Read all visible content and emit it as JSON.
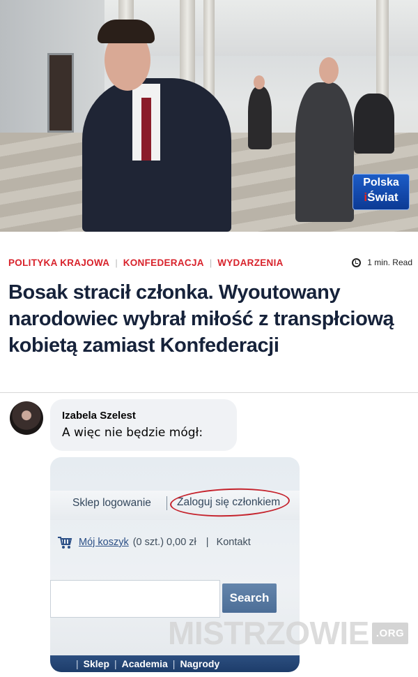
{
  "article": {
    "tv_logo": {
      "line1": "Polska",
      "dot_letter": "i",
      "line2": "Świat"
    },
    "categories": [
      "POLITYKA KRAJOWA",
      "KONFEDERACJA",
      "WYDARZENIA"
    ],
    "read_time": "1 min. Read",
    "title": "Bosak stracił członka. Wyoutowany narodowiec wybrał miłość z transpłciową kobietą zamiast Konfederacji",
    "accent_color": "#d8222b",
    "title_color": "#16223a"
  },
  "comment": {
    "author": "Izabela Szelest",
    "text": "A więc nie będzie mógł:"
  },
  "attached_image": {
    "nav": {
      "shop_login": "Sklep logowanie",
      "member_login": "Zaloguj się członkiem"
    },
    "cart": {
      "icon": "cart-icon",
      "link": "Mój koszyk",
      "summary": "(0 szt.) 0,00 zł",
      "separator": "|",
      "contact": "Kontakt"
    },
    "search_button": "Search",
    "bottom_nav": [
      "Sklep",
      "Academia",
      "Nagrody"
    ],
    "highlight_color": "#c5222c"
  },
  "watermark": {
    "text": "MISTRZOWIE",
    "domain": ".ORG"
  }
}
